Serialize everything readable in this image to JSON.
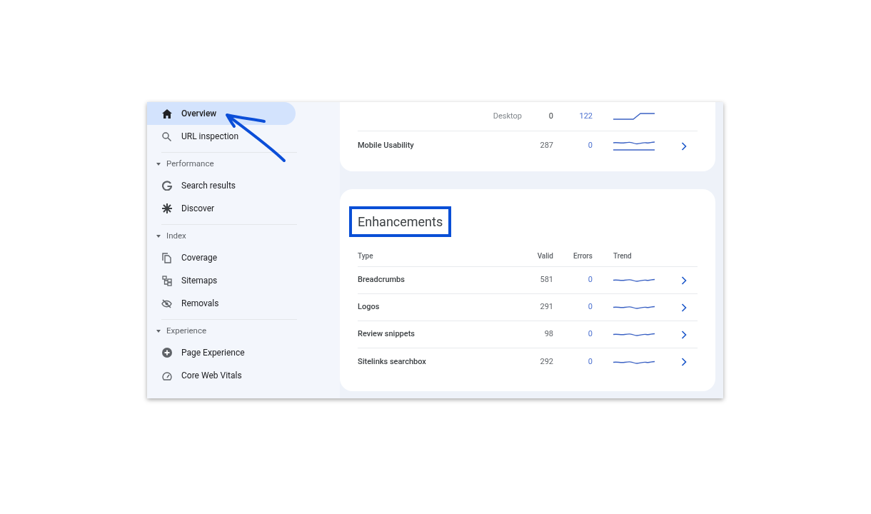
{
  "sidebar": {
    "top_items": [
      {
        "label": "Overview",
        "selected": true
      },
      {
        "label": "URL inspection",
        "selected": false
      }
    ],
    "sections": [
      {
        "title": "Performance",
        "expanded": true,
        "items": [
          {
            "label": "Search results",
            "selected": false
          },
          {
            "label": "Discover",
            "selected": false
          }
        ]
      },
      {
        "title": "Index",
        "expanded": true,
        "items": [
          {
            "label": "Coverage",
            "selected": false
          },
          {
            "label": "Sitemaps",
            "selected": false
          },
          {
            "label": "Removals",
            "selected": false
          }
        ]
      },
      {
        "title": "Experience",
        "expanded": true,
        "items": [
          {
            "label": "Page Experience",
            "selected": false
          },
          {
            "label": "Core Web Vitals",
            "selected": false
          }
        ]
      }
    ]
  },
  "experience_card": {
    "rows": [
      {
        "kind": "device",
        "type": "Desktop",
        "valid": "0",
        "errors": "122"
      },
      {
        "kind": "report",
        "type": "Mobile Usability",
        "valid": "287",
        "errors": "0"
      }
    ]
  },
  "enhancements": {
    "title": "Enhancements",
    "columns": [
      "Type",
      "Valid",
      "Errors",
      "Trend"
    ],
    "rows": [
      {
        "kind": "report",
        "type": "Breadcrumbs",
        "valid": "581",
        "errors": "0"
      },
      {
        "kind": "report",
        "type": "Logos",
        "valid": "291",
        "errors": "0"
      },
      {
        "kind": "report",
        "type": "Review snippets",
        "valid": "98",
        "errors": "0"
      },
      {
        "kind": "report",
        "type": "Sitelinks searchbox",
        "valid": "292",
        "errors": "0"
      }
    ]
  }
}
